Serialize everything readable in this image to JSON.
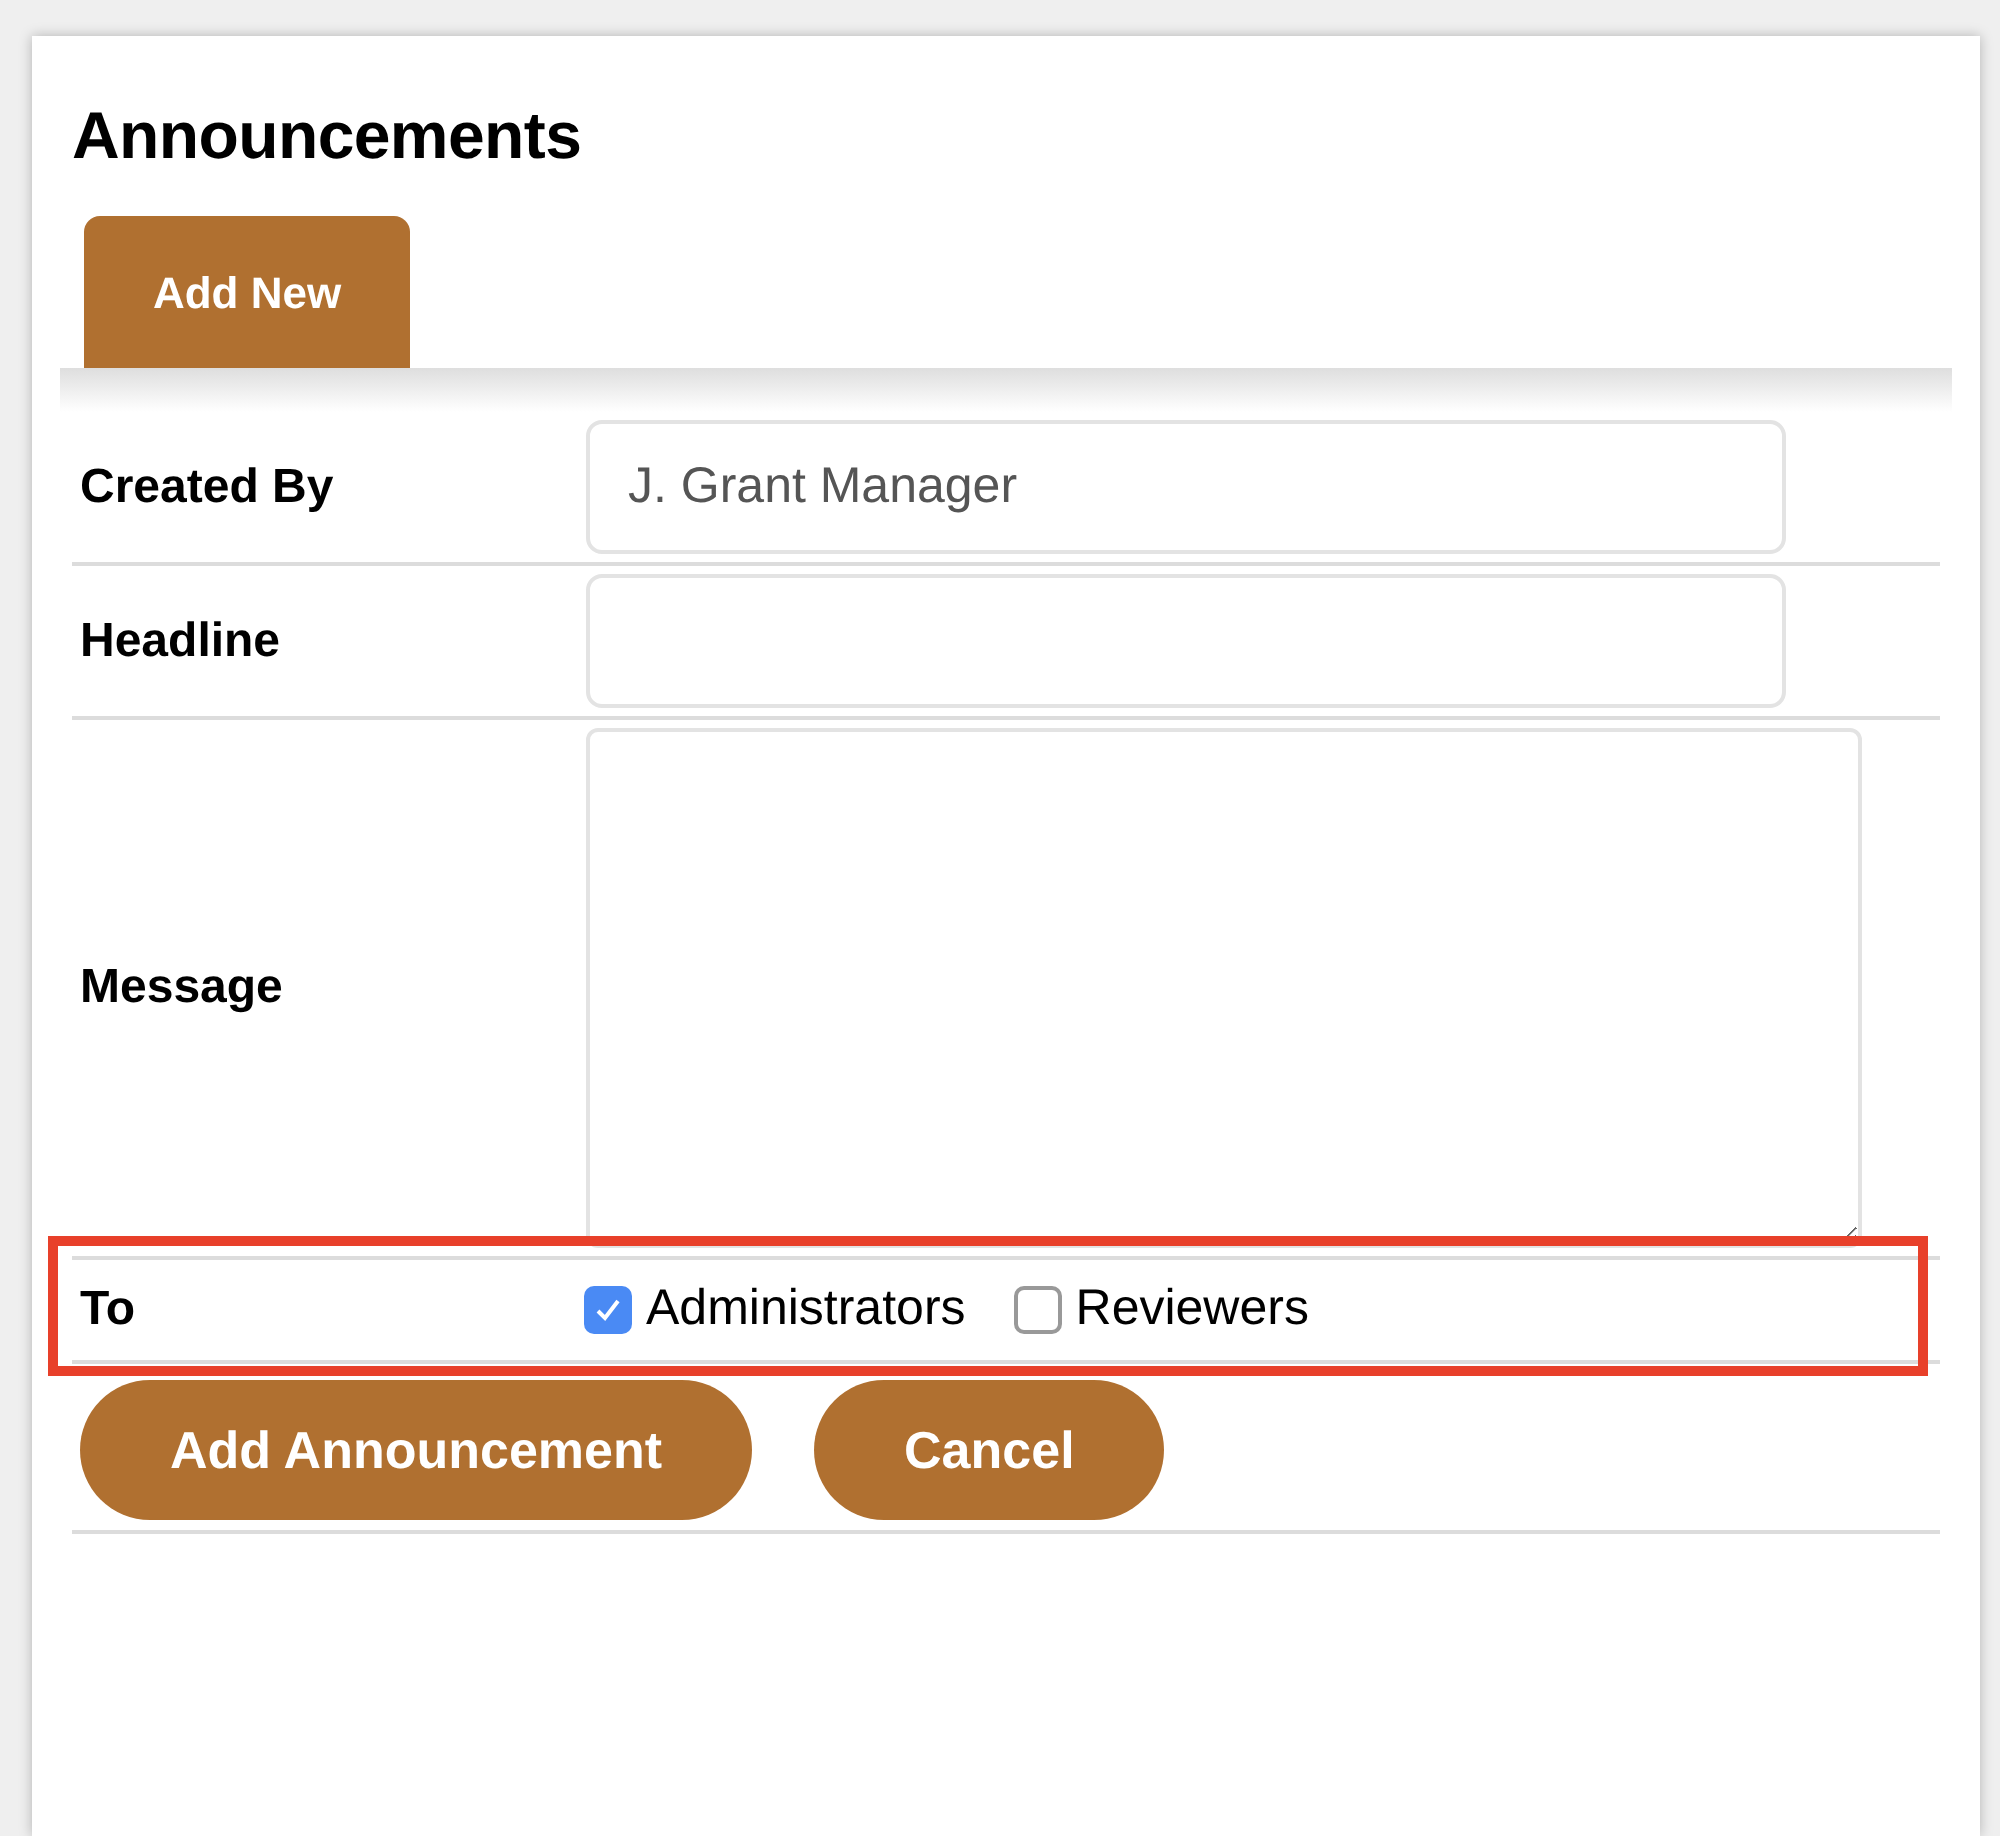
{
  "title": "Announcements",
  "tabs": [
    {
      "label": "Add New",
      "selected": true
    }
  ],
  "form": {
    "fields": [
      {
        "label": "Created By",
        "kind": "text",
        "value": "J. Grant Manager"
      },
      {
        "label": "Headline",
        "kind": "text"
      },
      {
        "label": "Message",
        "kind": "textarea"
      }
    ],
    "recipients": {
      "label": "To",
      "highlighted": true,
      "options": [
        {
          "label": "Administrators",
          "checked": true
        },
        {
          "label": "Reviewers",
          "checked": false
        }
      ]
    },
    "buttons": [
      "Add Announcement",
      "Cancel"
    ]
  }
}
